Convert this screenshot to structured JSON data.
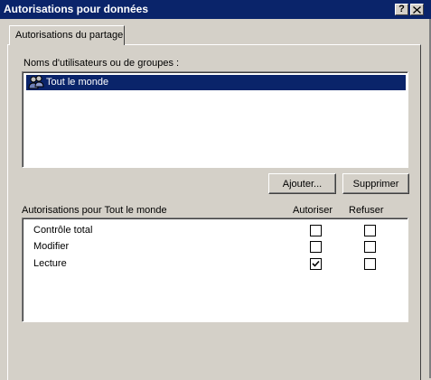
{
  "window": {
    "title": "Autorisations pour données",
    "help_label": "?",
    "close_label": "✕"
  },
  "tabs": [
    {
      "label": "Autorisations du partage",
      "active": true
    }
  ],
  "users": {
    "label": "Noms d'utilisateurs ou de groupes :",
    "items": [
      {
        "label": "Tout le monde",
        "icon": "users-group-icon",
        "selected": true
      }
    ],
    "add_button": "Ajouter...",
    "remove_button": "Supprimer"
  },
  "permissions": {
    "label": "Autorisations pour Tout le monde",
    "allow_header": "Autoriser",
    "deny_header": "Refuser",
    "rows": [
      {
        "name": "Contrôle total",
        "allow": false,
        "deny": false
      },
      {
        "name": "Modifier",
        "allow": false,
        "deny": false
      },
      {
        "name": "Lecture",
        "allow": true,
        "deny": false
      }
    ]
  },
  "colors": {
    "titlebar": "#0a246a",
    "face": "#d4d0c8",
    "selection": "#0a246a"
  }
}
